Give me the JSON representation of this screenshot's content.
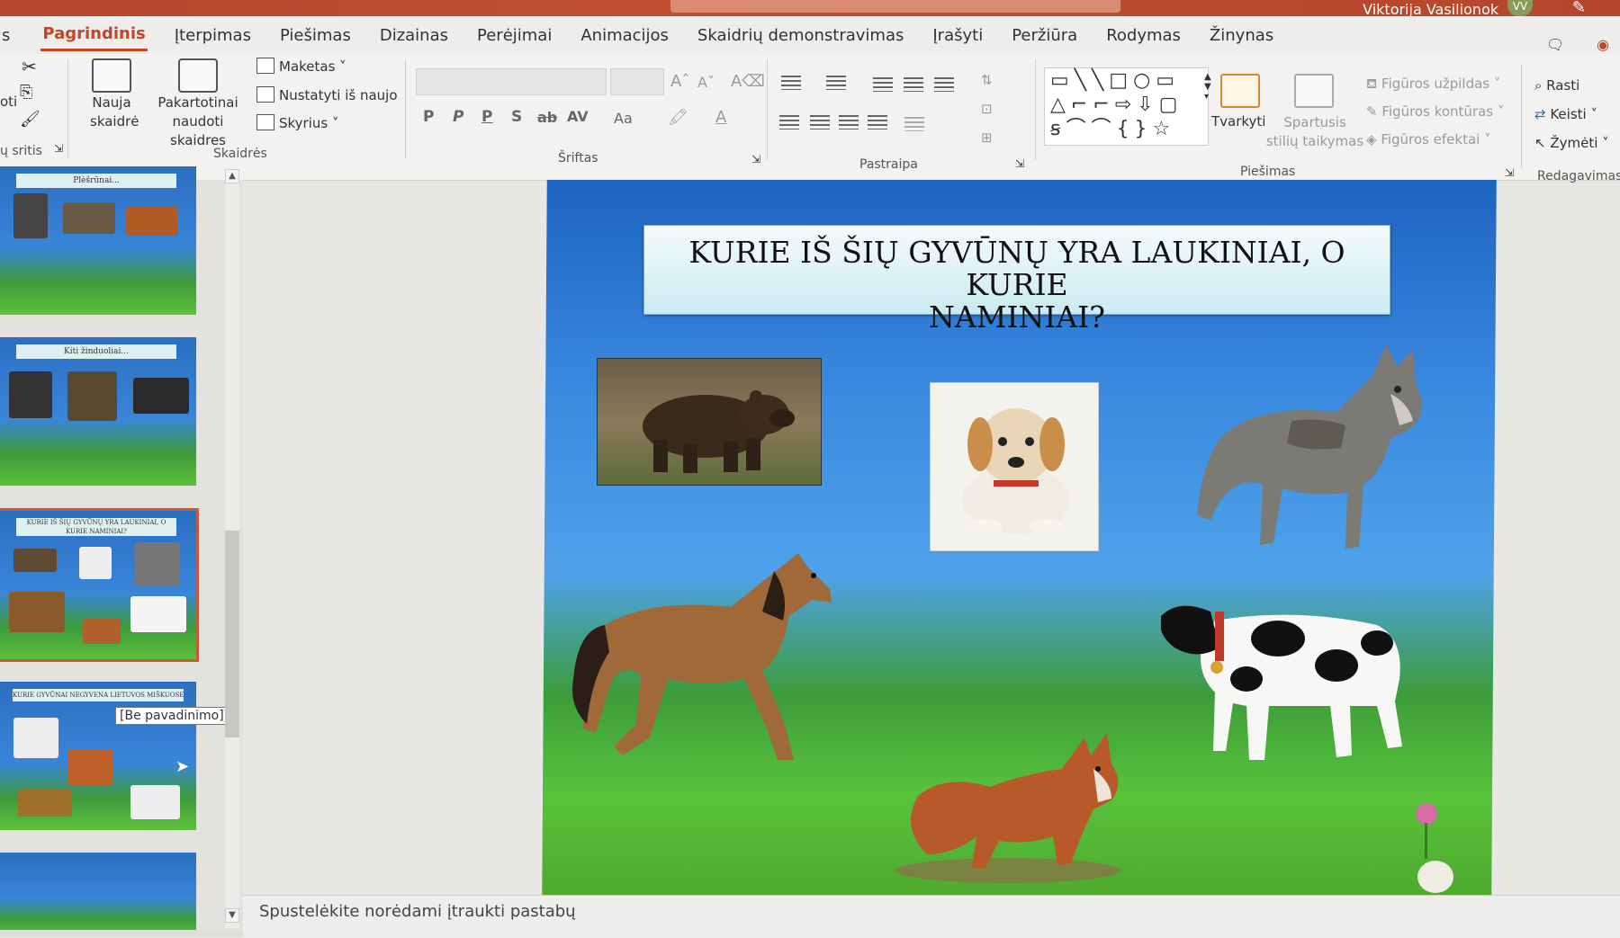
{
  "window": {
    "user_name": "Viktorija Vasilionok",
    "user_initials": "VV"
  },
  "tabs": [
    "s",
    "Pagrindinis",
    "Įterpimas",
    "Piešimas",
    "Dizainas",
    "Perėjimai",
    "Animacijos",
    "Skaidrių demonstravimas",
    "Įrašyti",
    "Peržiūra",
    "Rodymas",
    "Žinynas"
  ],
  "active_tab": "Pagrindinis",
  "ribbon": {
    "clipboard": {
      "partial_label": "oti",
      "group_label": "ų sritis"
    },
    "slides": {
      "new_slide": "Nauja skaidrė",
      "reuse_slides": "Pakartotinai naudoti skaidres",
      "layout": "Maketas",
      "reset": "Nustatyti iš naujo",
      "section": "Skyrius",
      "group_label": "Skaidrės"
    },
    "font": {
      "group_label": "Šriftas",
      "bold": "P",
      "italic": "P",
      "underline": "P",
      "shadow": "S",
      "strike": "ab",
      "spacing": "AV",
      "case": "Aa"
    },
    "paragraph": {
      "group_label": "Pastraipa"
    },
    "drawing": {
      "arrange": "Tvarkyti",
      "quick_styles": "Spartusis stilių taikymas",
      "shape_fill": "Figūros užpildas",
      "shape_outline": "Figūros kontūras",
      "shape_effects": "Figūros efektai",
      "group_label": "Piešimas"
    },
    "editing": {
      "find": "Rasti",
      "replace": "Keisti",
      "select": "Žymėti",
      "group_label": "Redagavimas"
    }
  },
  "thumbnails": [
    {
      "title": "Plėšrūnai..."
    },
    {
      "title": "Kiti žinduoliai..."
    },
    {
      "title": "KURIE IŠ ŠIŲ GYVŪNŲ YRA LAUKINIAI, O KURIE NAMINIAI?"
    },
    {
      "title": "KURIE GYVŪNAI NEGYVENA LIETUVOS MIŠKUOSE? KODĖL?"
    },
    {
      "title": ""
    }
  ],
  "tooltip": "[Be pavadinimo]",
  "slide": {
    "title_line1": "KURIE IŠ ŠIŲ GYVŪNŲ YRA LAUKINIAI, O KURIE",
    "title_line2": "NAMINIAI?"
  },
  "notes_placeholder": "Spustelėkite norėdami įtraukti pastabų",
  "colors": {
    "accent": "#c0462a",
    "titlebar": "#b4472c",
    "slide_sky": "#3a8ae0",
    "slide_grass": "#4faa2f"
  }
}
